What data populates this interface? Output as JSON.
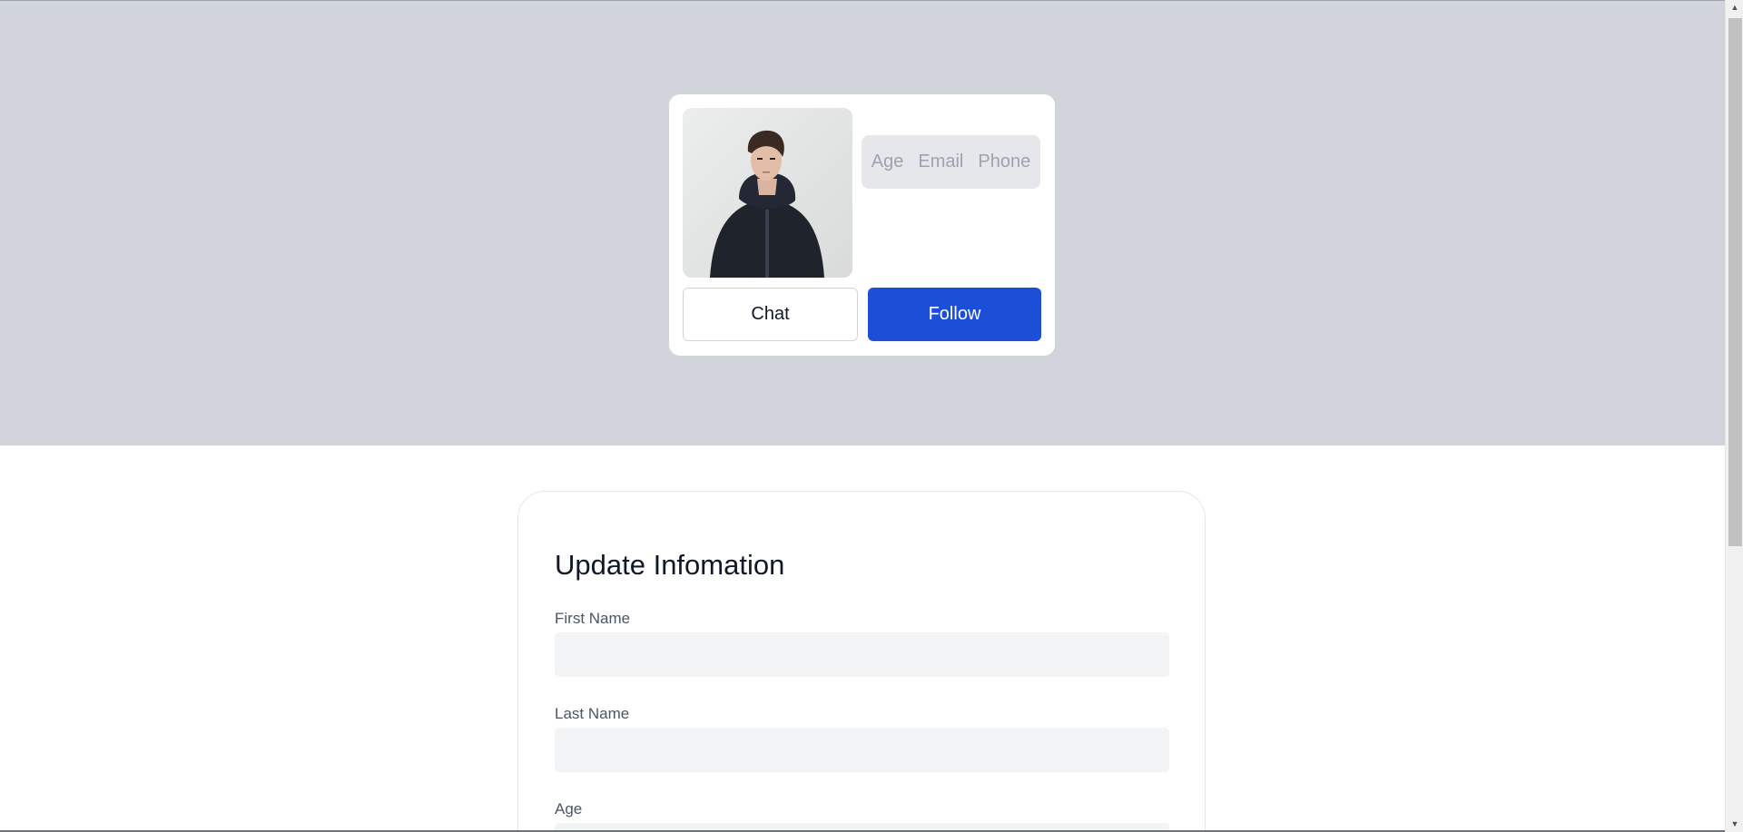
{
  "profile": {
    "avatar_alt": "profile photo",
    "info_labels": [
      "Age",
      "Email",
      "Phone"
    ],
    "chat_label": "Chat",
    "follow_label": "Follow"
  },
  "form": {
    "title": "Update Infomation",
    "fields": [
      {
        "label": "First Name",
        "value": "",
        "placeholder": ""
      },
      {
        "label": "Last Name",
        "value": "",
        "placeholder": ""
      },
      {
        "label": "Age",
        "value": "",
        "placeholder": ""
      }
    ]
  },
  "scrollbar": {
    "up_icon": "scroll-up-arrow",
    "down_icon": "scroll-down-arrow"
  },
  "colors": {
    "hero_background": "#d1d5db",
    "follow_button": "#1d4ed8",
    "input_background": "#f3f4f6",
    "pill_background": "#e5e7eb"
  }
}
